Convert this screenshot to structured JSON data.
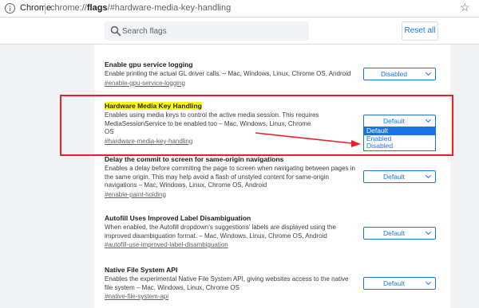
{
  "address_bar": {
    "site_label": "Chrome",
    "url_prefix": "chrome://",
    "url_host": "flags",
    "url_rest": "/#hardware-media-key-handling"
  },
  "header": {
    "search_placeholder": "Search flags",
    "reset_label": "Reset all"
  },
  "flags": [
    {
      "title": "Enable gpu service logging",
      "description": "Enable printing the actual GL driver calls. – Mac, Windows, Linux, Chrome OS, Android",
      "link": "#enable-gpu-service-logging",
      "value": "Disabled"
    },
    {
      "title": "Hardware Media Key Handling",
      "description": "Enables using media keys to control the active media session. This requires MediaSessionService to be enabled too – Mac, Windows, Linux, Chrome OS",
      "link": "#hardware-media-key-handling",
      "value": "Default",
      "options": [
        "Default",
        "Enabled",
        "Disabled"
      ]
    },
    {
      "title": "Delay the commit to screen for same-origin navigations",
      "description": "Enables a delay before commiting the page to screen when navigating between pages in the same origin. This may help avoid a flash of unstyled content for same-origin navigations – Mac, Windows, Linux, Chrome OS, Android",
      "link": "#enable-paint-holding",
      "value": "Default"
    },
    {
      "title": "Autofill Uses Improved Label Disambiguation",
      "description": "When enabled, the Autofill dropdown's suggestions' labels are displayed using the improved disambiguation format. – Mac, Windows, Linux, Chrome OS, Android",
      "link": "#autofill-use-improved-label-disambiguation",
      "value": "Default"
    },
    {
      "title": "Native File System API",
      "description": "Enables the experimental Native File System API, giving websites access to the native file system – Mac, Windows, Linux, Chrome OS",
      "link": "#native-file-system-api",
      "value": "Default"
    }
  ],
  "colors": {
    "accent": "#1a73e8",
    "highlight": "#ffff00",
    "annotation": "#e8202a"
  }
}
